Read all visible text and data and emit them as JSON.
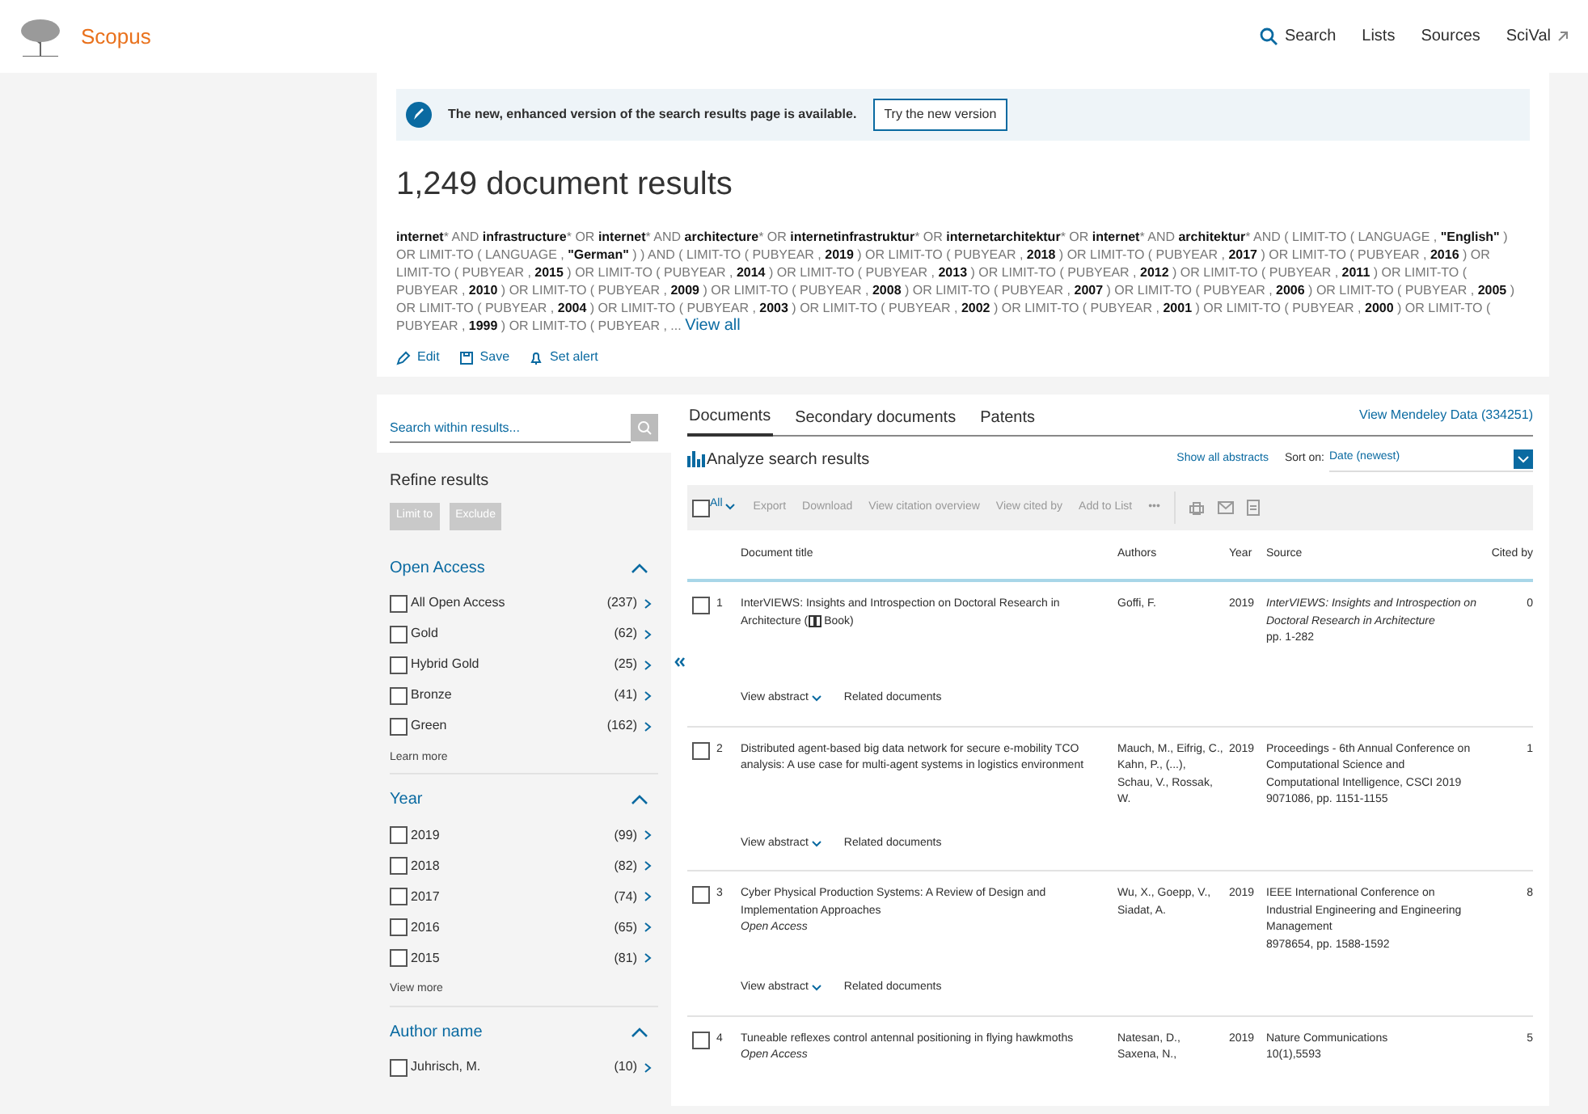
{
  "header": {
    "brand": "Scopus",
    "nav": [
      {
        "label": "Search",
        "kind": "search"
      },
      {
        "label": "Lists",
        "kind": "plain"
      },
      {
        "label": "Sources",
        "kind": "plain"
      },
      {
        "label": "SciVal",
        "kind": "external"
      }
    ]
  },
  "banner": {
    "text": "The new, enhanced version of the search results page is available.",
    "button": "Try the new version"
  },
  "results_title": "1,249 document results",
  "query": "**internet*** AND **infrastructure*** OR **internet*** AND **architecture*** OR **internetinfrastruktur*** OR **internetarchitektur*** OR **internet*** AND **architektur*** AND ( LIMIT-TO ( LANGUAGE , **\"English\"** ) OR LIMIT-TO ( LANGUAGE , **\"German\"** ) ) AND ( LIMIT-TO ( PUBYEAR , **2019** ) OR LIMIT-TO ( PUBYEAR , **2018** ) OR LIMIT-TO ( PUBYEAR , **2017** ) OR LIMIT-TO ( PUBYEAR , **2016** ) OR LIMIT-TO ( PUBYEAR , **2015** ) OR LIMIT-TO ( PUBYEAR , **2014** ) OR LIMIT-TO ( PUBYEAR , **2013** ) OR LIMIT-TO ( PUBYEAR , **2012** ) OR LIMIT-TO ( PUBYEAR , **2011** ) OR LIMIT-TO ( PUBYEAR , **2010** ) OR LIMIT-TO ( PUBYEAR , **2009** ) OR LIMIT-TO ( PUBYEAR , **2008** ) OR LIMIT-TO ( PUBYEAR , **2007** ) OR LIMIT-TO ( PUBYEAR , **2006** ) OR LIMIT-TO ( PUBYEAR , **2005** ) OR LIMIT-TO ( PUBYEAR , **2004** ) OR LIMIT-TO ( PUBYEAR , **2003** ) OR LIMIT-TO ( PUBYEAR , **2002** ) OR LIMIT-TO ( PUBYEAR , **2001** ) OR LIMIT-TO ( PUBYEAR , **2000** ) OR LIMIT-TO ( PUBYEAR , **1999** ) OR LIMIT-TO ( PUBYEAR , ...",
  "view_all": "View all",
  "query_actions": [
    {
      "label": "Edit",
      "kind": "edit"
    },
    {
      "label": "Save",
      "kind": "save"
    },
    {
      "label": "Set alert",
      "kind": "alert"
    }
  ],
  "sidebar": {
    "search_placeholder": "Search within results...",
    "refine_title": "Refine results",
    "buttons": [
      "Limit to",
      "Exclude"
    ],
    "facets": [
      {
        "title": "Open Access",
        "expanded": true,
        "items": [
          {
            "label": "All Open Access",
            "count": "(237)",
            "checked": false
          },
          {
            "label": "Gold",
            "count": "(62)",
            "checked": false
          },
          {
            "label": "Hybrid Gold",
            "count": "(25)",
            "checked": false
          },
          {
            "label": "Bronze",
            "count": "(41)",
            "checked": false
          },
          {
            "label": "Green",
            "count": "(162)",
            "checked": false
          }
        ],
        "footer": "Learn more"
      },
      {
        "title": "Year",
        "expanded": true,
        "items": [
          {
            "label": "2019",
            "count": "(99)",
            "checked": false
          },
          {
            "label": "2018",
            "count": "(82)",
            "checked": false
          },
          {
            "label": "2017",
            "count": "(74)",
            "checked": false
          },
          {
            "label": "2016",
            "count": "(65)",
            "checked": false
          },
          {
            "label": "2015",
            "count": "(81)",
            "checked": false
          }
        ],
        "footer": "View more"
      },
      {
        "title": "Author name",
        "expanded": true,
        "items": [
          {
            "label": "Juhrisch, M.",
            "count": "(10)",
            "checked": false
          }
        ]
      }
    ]
  },
  "results": {
    "tabs": [
      {
        "label": "Documents",
        "selected": true
      },
      {
        "label": "Secondary documents",
        "selected": false
      },
      {
        "label": "Patents",
        "selected": false
      }
    ],
    "mendeley": "View Mendeley Data (334251)",
    "analyze": "Analyze search results",
    "show_abstracts": "Show all abstracts",
    "sort_label": "Sort on:",
    "sort_value": "Date (newest)",
    "select_all": {
      "label": "All",
      "checked": false
    },
    "actions": [
      "Export",
      "Download",
      "View citation overview",
      "View cited by",
      "Add to List",
      "•••"
    ],
    "columns": [
      "Document title",
      "Authors",
      "Year",
      "Source",
      "Cited by"
    ],
    "rows": [
      {
        "n": "1",
        "checked": false,
        "title": "InterVIEWS: Insights and Introspection on Doctoral Research in Architecture (",
        "book": "Book)",
        "open_access": "",
        "authors": "Goffi, F.",
        "year": "2019",
        "source_title": "InterVIEWS: Insights and Introspection on Doctoral Research in Architecture",
        "source_italic": true,
        "source_detail": "pp. 1-282",
        "cited": "0",
        "links": [
          "View abstract",
          "Related documents"
        ]
      },
      {
        "n": "2",
        "checked": false,
        "title": "Distributed agent-based big data network for secure e-mobility TCO analysis: A use case for multi-agent systems in logistics environment",
        "open_access": "",
        "authors": "Mauch, M., Eifrig, C., Kahn, P., (...), Schau, V., Rossak, W.",
        "year": "2019",
        "source_title": "Proceedings - 6th Annual Conference on Computational Science and Computational Intelligence, CSCI 2019",
        "source_italic": false,
        "source_detail": "9071086, pp. 1151-1155",
        "cited": "1",
        "links": [
          "View abstract",
          "Related documents"
        ]
      },
      {
        "n": "3",
        "checked": false,
        "title": "Cyber Physical Production Systems: A Review of Design and Implementation Approaches",
        "open_access": "Open Access",
        "authors": "Wu, X., Goepp, V., Siadat, A.",
        "year": "2019",
        "source_title": "IEEE International Conference on Industrial Engineering and Engineering Management",
        "source_italic": false,
        "source_detail": "8978654, pp. 1588-1592",
        "cited": "8",
        "links": [
          "View abstract",
          "Related documents"
        ]
      },
      {
        "n": "4",
        "checked": false,
        "title": "Tuneable reflexes control antennal positioning in flying hawkmoths",
        "open_access": "Open Access",
        "authors": "Natesan, D., Saxena, N.,",
        "year": "2019",
        "source_title": "Nature Communications",
        "source_italic": false,
        "source_detail": "10(1),5593",
        "cited": "5"
      }
    ]
  }
}
